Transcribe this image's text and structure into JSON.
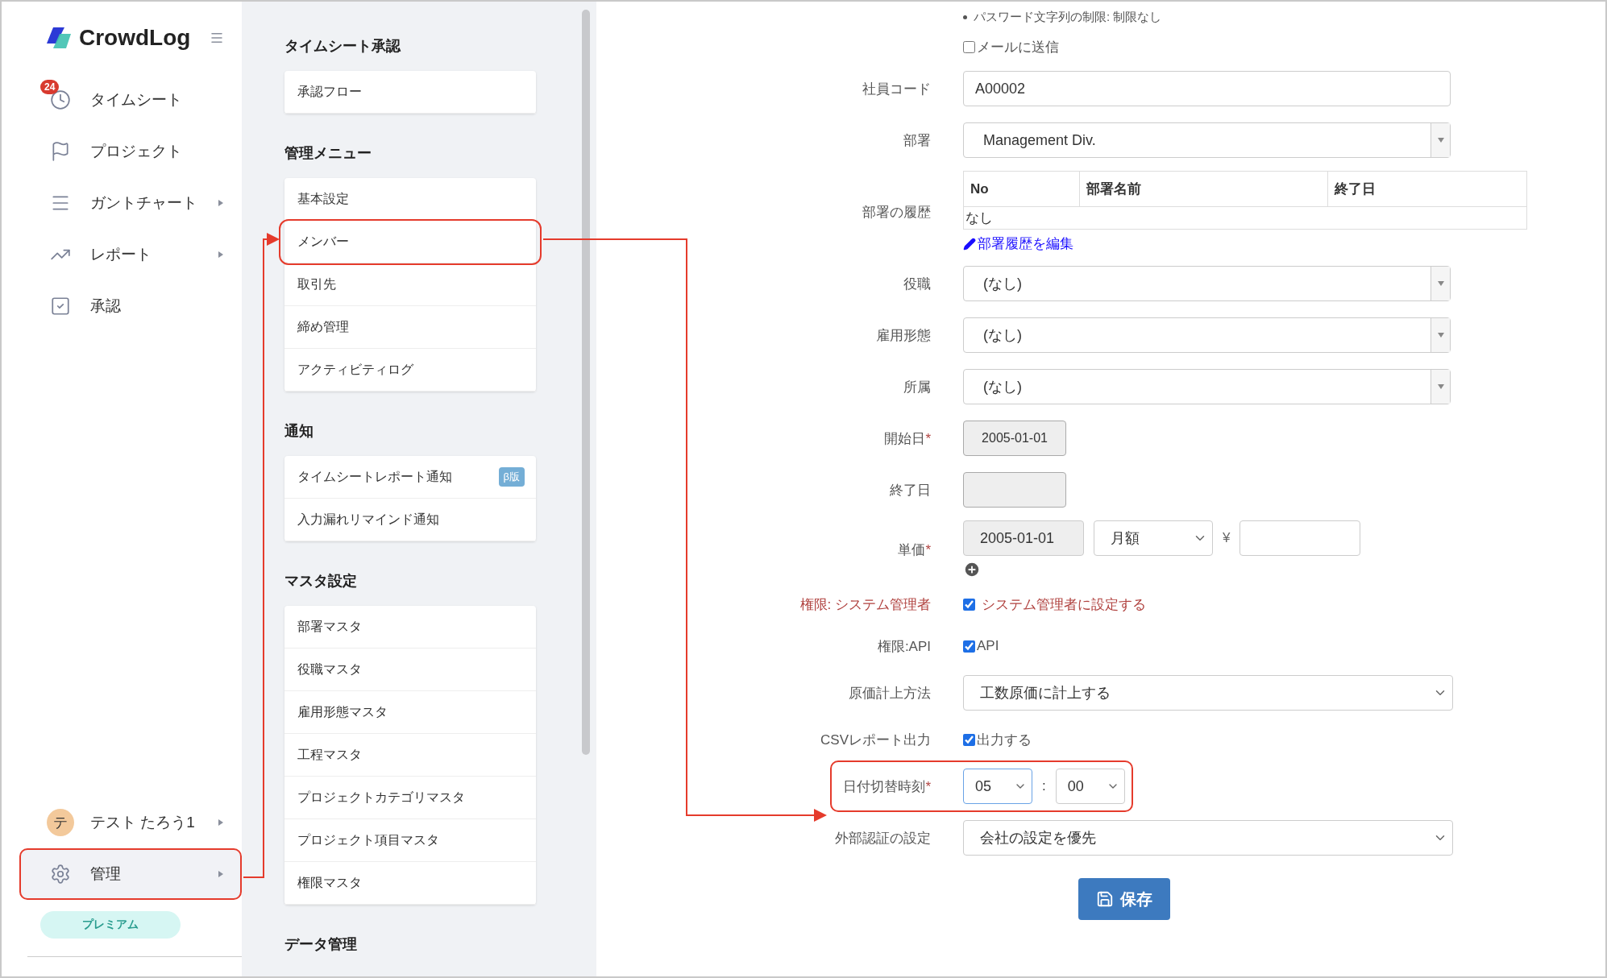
{
  "sidebar": {
    "logo": "CrowdLog",
    "nav": [
      {
        "label": "タイムシート",
        "badge": "24",
        "submenu": false
      },
      {
        "label": "プロジェクト",
        "submenu": false
      },
      {
        "label": "ガントチャート",
        "submenu": true
      },
      {
        "label": "レポート",
        "submenu": true
      },
      {
        "label": "承認",
        "submenu": false
      }
    ],
    "user": {
      "initial": "テ",
      "name": "テスト たろう1",
      "submenu": true
    },
    "admin": {
      "label": "管理",
      "submenu": true,
      "highlighted": true
    },
    "plan": "プレミアム"
  },
  "menu": {
    "sections": [
      {
        "title": "タイムシート承認",
        "items": [
          {
            "label": "承認フロー",
            "highlighted": false
          }
        ]
      },
      {
        "title": "管理メニュー",
        "items": [
          {
            "label": "基本設定",
            "highlighted": false
          },
          {
            "label": "メンバー",
            "highlighted": true
          },
          {
            "label": "取引先",
            "highlighted": false
          },
          {
            "label": "締め管理",
            "highlighted": false
          },
          {
            "label": "アクティビティログ",
            "highlighted": false
          }
        ]
      },
      {
        "title": "通知",
        "items": [
          {
            "label": "タイムシートレポート通知",
            "badge": "β版",
            "highlighted": false
          },
          {
            "label": "入力漏れリマインド通知",
            "highlighted": false
          }
        ]
      },
      {
        "title": "マスタ設定",
        "items": [
          {
            "label": "部署マスタ",
            "highlighted": false
          },
          {
            "label": "役職マスタ",
            "highlighted": false
          },
          {
            "label": "雇用形態マスタ",
            "highlighted": false
          },
          {
            "label": "工程マスタ",
            "highlighted": false
          },
          {
            "label": "プロジェクトカテゴリマスタ",
            "highlighted": false
          },
          {
            "label": "プロジェクト項目マスタ",
            "highlighted": false
          },
          {
            "label": "権限マスタ",
            "highlighted": false
          }
        ]
      },
      {
        "title": "データ管理"
      }
    ]
  },
  "form": {
    "rows": [
      {
        "kind": "note",
        "text": "パスワード文字列の制限: 制限なし"
      },
      {
        "kind": "checkbox",
        "option": "メールに送信",
        "checked": false
      },
      {
        "kind": "text",
        "label": "社員コード",
        "value": "A00002"
      },
      {
        "kind": "combo",
        "label": "部署",
        "value": "Management Div."
      },
      {
        "kind": "table",
        "label": "部署の履歴",
        "columns": [
          "No",
          "部署名前",
          "終了日"
        ],
        "empty": "なし",
        "link": "部署履歴を編集"
      },
      {
        "kind": "combo",
        "label": "役職",
        "value": "(なし)"
      },
      {
        "kind": "combo",
        "label": "雇用形態",
        "value": "(なし)"
      },
      {
        "kind": "combo",
        "label": "所属",
        "value": "(なし)"
      },
      {
        "kind": "date",
        "label": "開始日",
        "required_mark": "*",
        "value": "2005-01-01"
      },
      {
        "kind": "date",
        "label": "終了日"
      },
      {
        "kind": "price",
        "label": "単価",
        "required_mark": "*",
        "date": "2005-01-01",
        "period": "月額",
        "currency": "¥"
      },
      {
        "kind": "checkbox",
        "label": "権限: システム管理者",
        "option": "システム管理者に設定する",
        "checked": true,
        "danger": true
      },
      {
        "kind": "checkbox",
        "label": "権限:API",
        "option": "API",
        "checked": true
      },
      {
        "kind": "select",
        "label": "原価計上方法",
        "value": "工数原価に計上する"
      },
      {
        "kind": "checkbox",
        "label": "CSVレポート出力",
        "option": "出力する",
        "checked": true
      },
      {
        "kind": "time",
        "label": "日付切替時刻",
        "required_mark": "*",
        "hour": "05",
        "separator": ":",
        "minute": "00",
        "highlighted": true
      },
      {
        "kind": "select",
        "label": "外部認証の設定",
        "value": "会社の設定を優先"
      }
    ],
    "save": "保存"
  }
}
